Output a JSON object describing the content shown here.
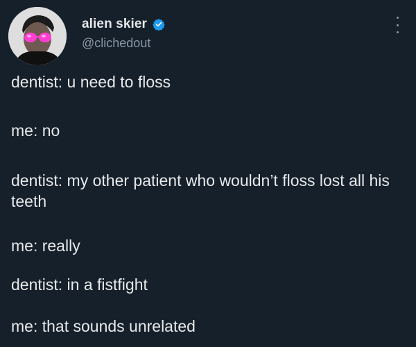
{
  "author": {
    "display_name": "alien skier",
    "handle": "@clichedout",
    "verified": true
  },
  "tweet": {
    "lines": [
      "dentist: u need to floss",
      "me: no",
      "dentist: my other patient who wouldn’t floss lost all his teeth",
      "me: really",
      "dentist: in a fistfight",
      "me: that sounds unrelated"
    ]
  },
  "icons": {
    "verified": "verified-badge-icon",
    "more": "more-options-icon"
  },
  "colors": {
    "background": "#15202b",
    "text": "#e7e9ea",
    "secondary_text": "#8b98a5",
    "verified_blue": "#1d9bf0"
  }
}
